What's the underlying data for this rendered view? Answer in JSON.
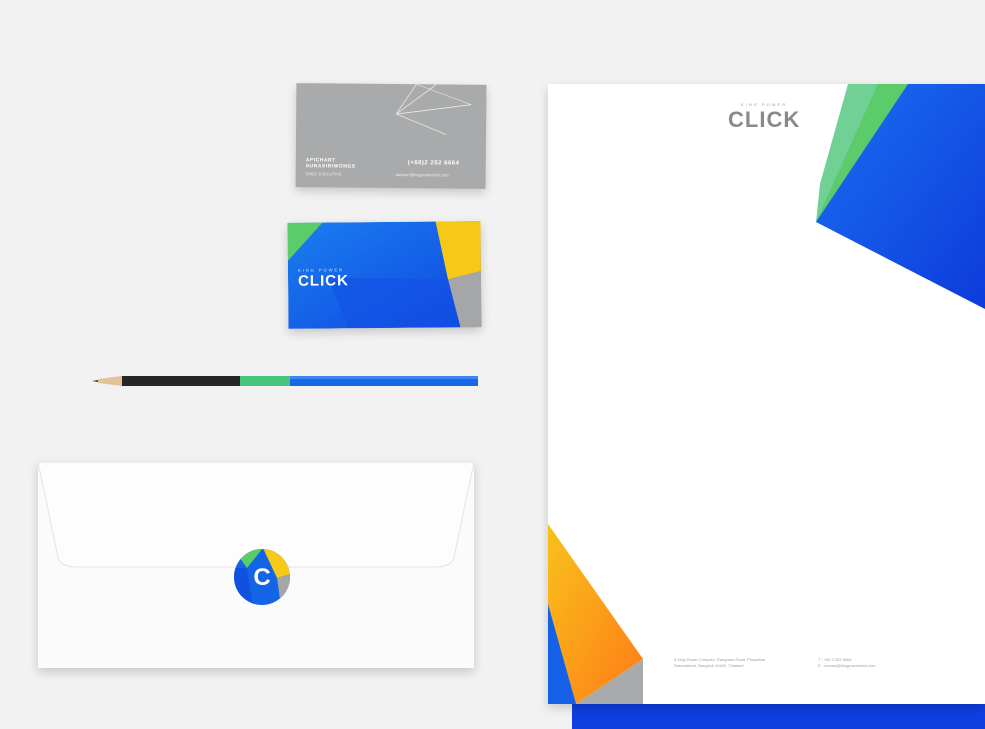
{
  "brand": {
    "tagline": "KING POWER",
    "name": "CLICK"
  },
  "business_card_gray": {
    "person_name_line1": "APICHART",
    "person_name_line2": "SURASIRIWONGS",
    "person_title": "CHIEF EXECUTIVE",
    "phone": "(+66)2 252 6664",
    "email": "apichart@kingpowerclick.com"
  },
  "envelope_logo_letter": "C",
  "letterhead": {
    "address_line1": "8 King Power Complex, Rangnam Road, Phayathai",
    "address_line2": "Ratchathewi, Bangkok 10400, Thailand",
    "contact_phone": "T : +66 2 252 6664",
    "contact_email": "E : contact@kingpowerclick.com"
  },
  "colors": {
    "blue": "#1460e6",
    "dark_blue": "#0f3fe0",
    "green": "#5ccb6a",
    "yellow": "#f6c918",
    "orange": "#ff8a18",
    "gray": "#a9aaab"
  }
}
